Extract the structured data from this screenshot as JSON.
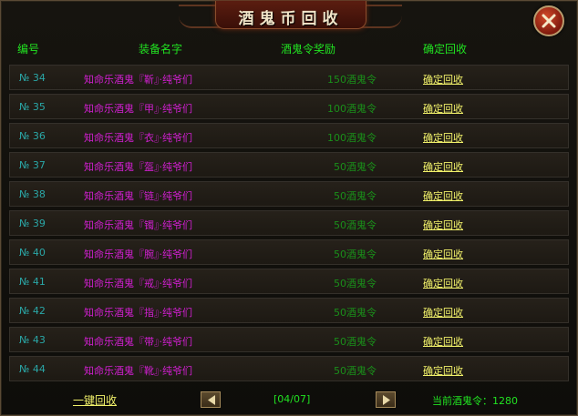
{
  "title": "酒鬼币回收",
  "header": {
    "col_no": "编号",
    "col_name": "装备名字",
    "col_reward": "酒鬼令奖励",
    "col_action": "确定回收"
  },
  "rows": [
    {
      "no": "№ 34",
      "name": "知命乐酒鬼『靳』·纯爷们",
      "reward": "150酒鬼令",
      "action": "确定回收"
    },
    {
      "no": "№ 35",
      "name": "知命乐酒鬼『甲』·纯爷们",
      "reward": "100酒鬼令",
      "action": "确定回收"
    },
    {
      "no": "№ 36",
      "name": "知命乐酒鬼『衣』·纯爷们",
      "reward": "100酒鬼令",
      "action": "确定回收"
    },
    {
      "no": "№ 37",
      "name": "知命乐酒鬼『盔』·纯爷们",
      "reward": "50酒鬼令",
      "action": "确定回收"
    },
    {
      "no": "№ 38",
      "name": "知命乐酒鬼『链』·纯爷们",
      "reward": "50酒鬼令",
      "action": "确定回收"
    },
    {
      "no": "№ 39",
      "name": "知命乐酒鬼『镯』·纯爷们",
      "reward": "50酒鬼令",
      "action": "确定回收"
    },
    {
      "no": "№ 40",
      "name": "知命乐酒鬼『腕』·纯爷们",
      "reward": "50酒鬼令",
      "action": "确定回收"
    },
    {
      "no": "№ 41",
      "name": "知命乐酒鬼『戒』·纯爷们",
      "reward": "50酒鬼令",
      "action": "确定回收"
    },
    {
      "no": "№ 42",
      "name": "知命乐酒鬼『指』·纯爷们",
      "reward": "50酒鬼令",
      "action": "确定回收"
    },
    {
      "no": "№ 43",
      "name": "知命乐酒鬼『带』·纯爷们",
      "reward": "50酒鬼令",
      "action": "确定回收"
    },
    {
      "no": "№ 44",
      "name": "知命乐酒鬼『靴』·纯爷们",
      "reward": "50酒鬼令",
      "action": "确定回收"
    }
  ],
  "footer": {
    "recycle_all": "一键回收",
    "page": "[04/07]",
    "current_tokens": "当前酒鬼令：1280"
  },
  "icons": {
    "close": "close-icon",
    "prev": "arrow-left-icon",
    "next": "arrow-right-icon"
  },
  "colors": {
    "header_green": "#21e221",
    "number_teal": "#2aa7a7",
    "item_magenta": "#d11fd1",
    "reward_green": "#1a8f1a",
    "link_yellow": "#f1f16a"
  }
}
